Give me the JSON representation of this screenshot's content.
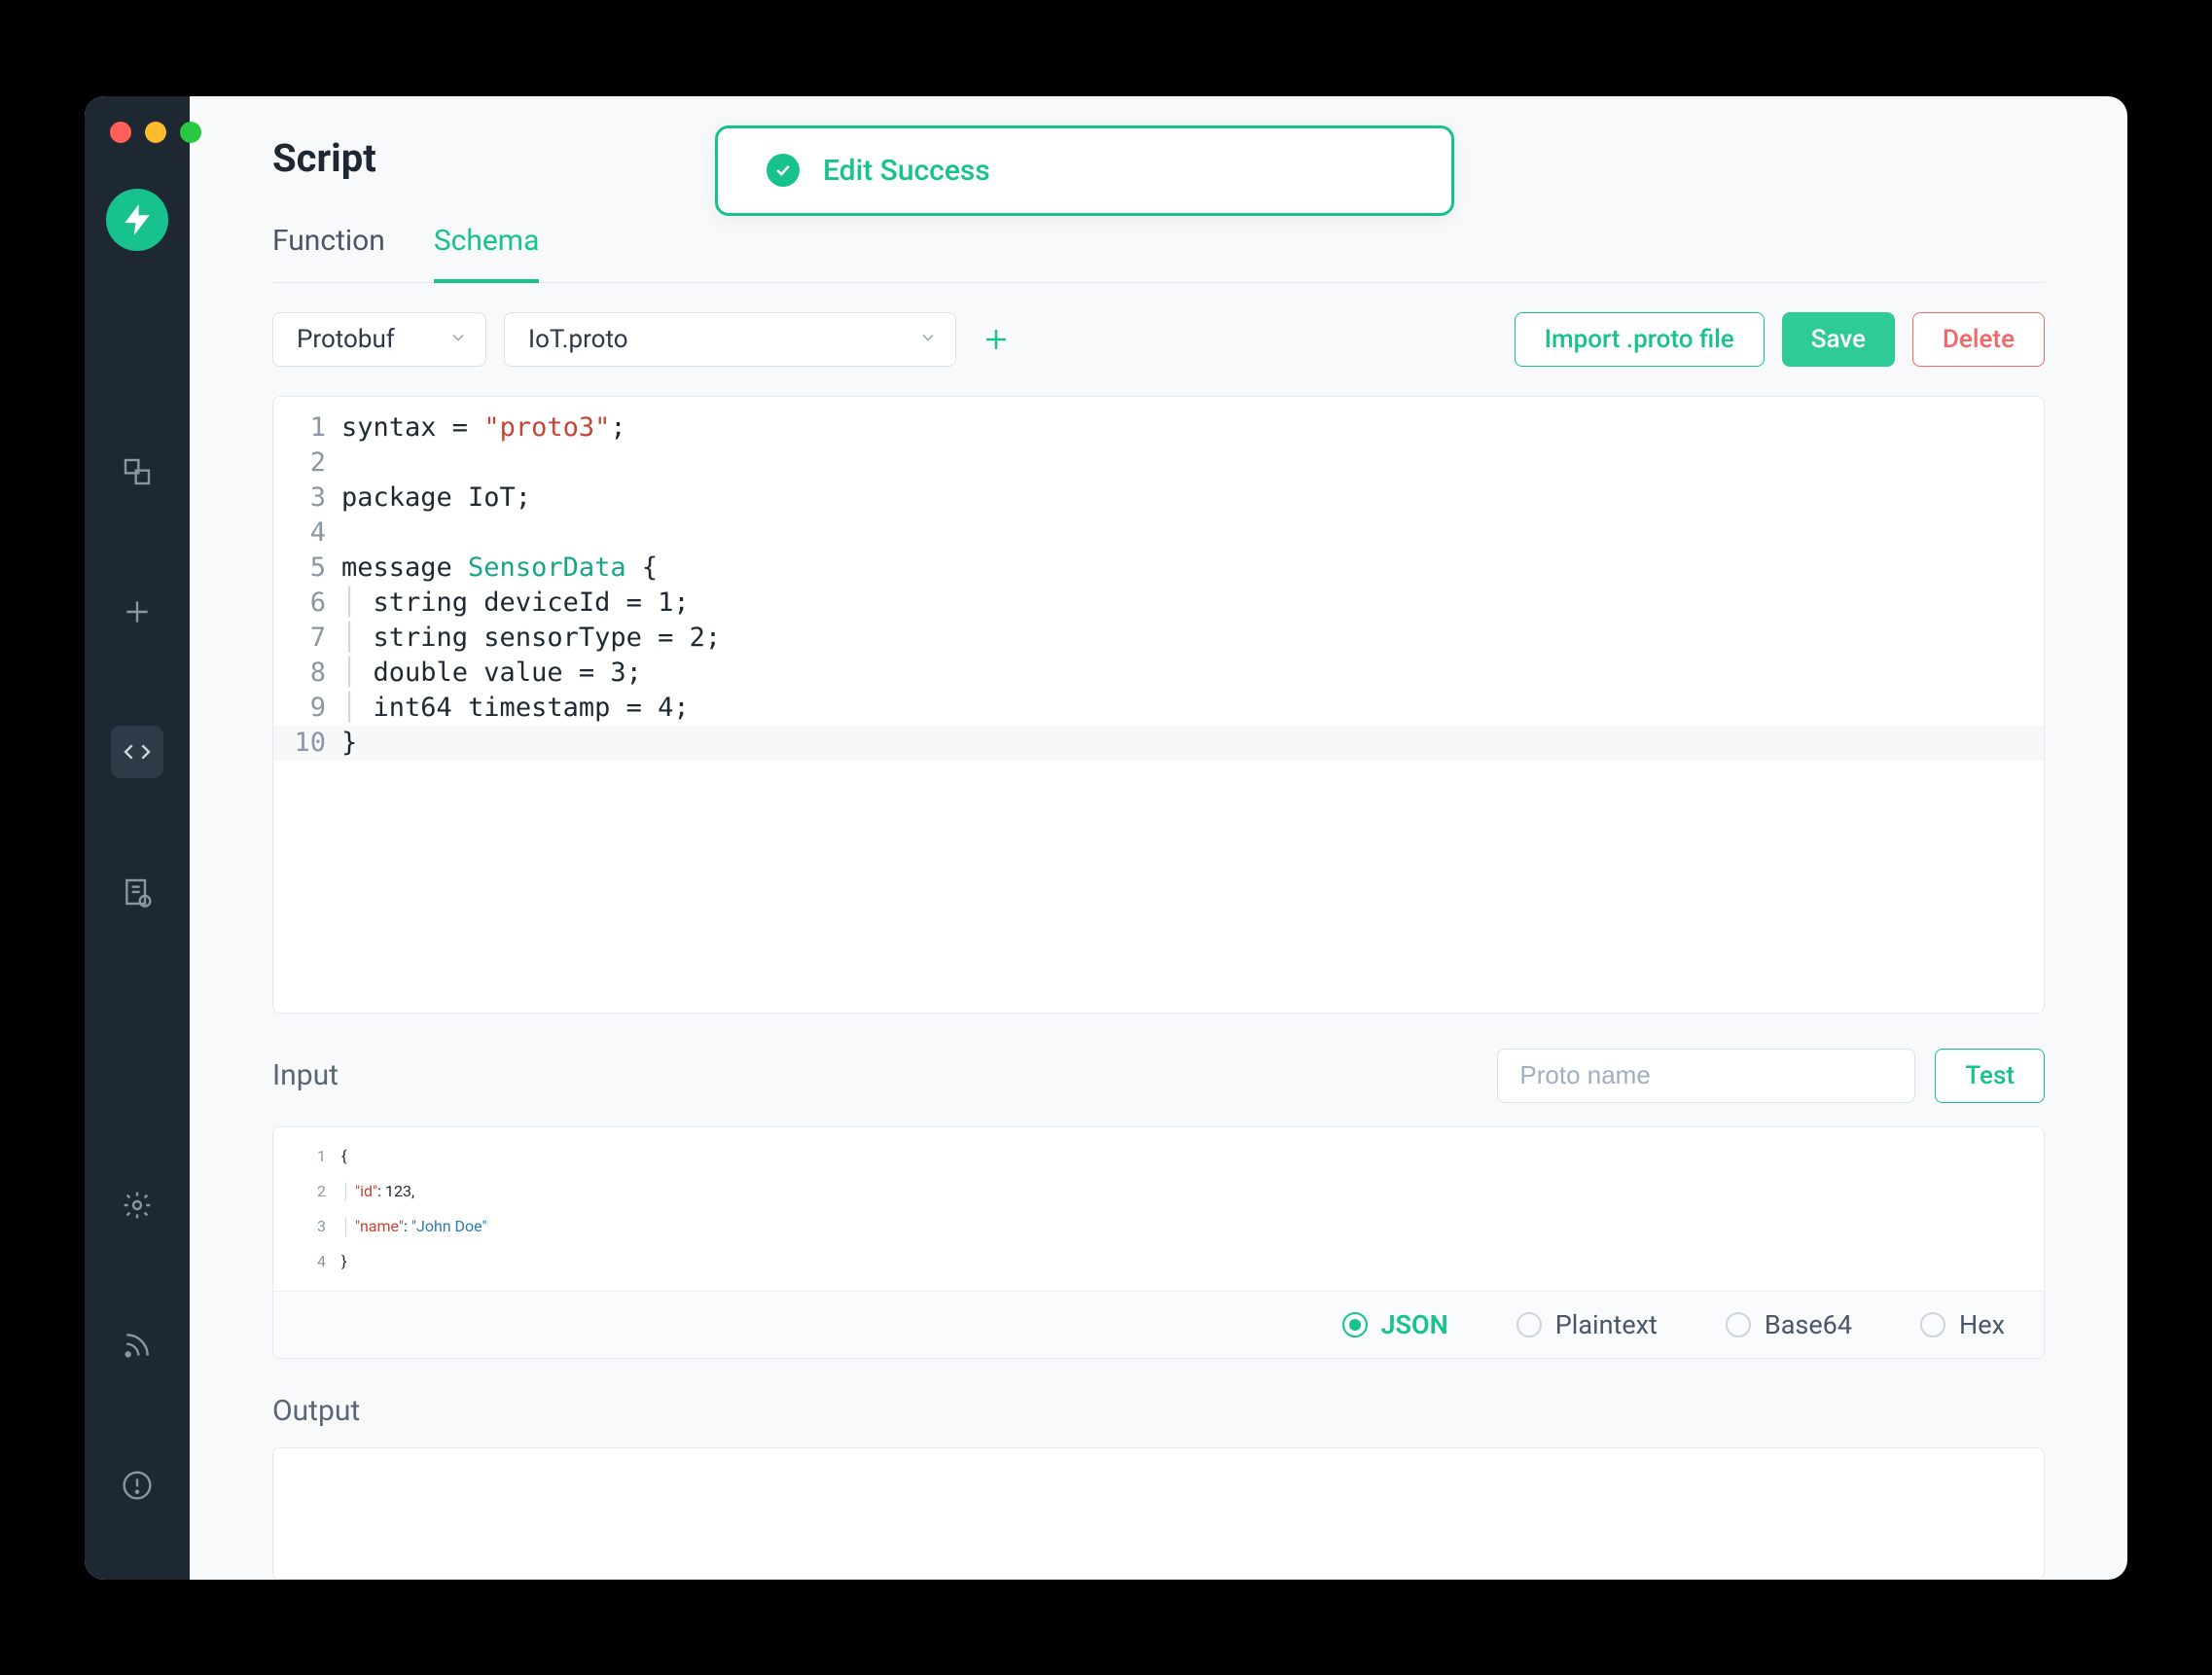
{
  "page": {
    "title": "Script"
  },
  "toast": {
    "message": "Edit Success"
  },
  "tabs": [
    {
      "label": "Function",
      "active": false
    },
    {
      "label": "Schema",
      "active": true
    }
  ],
  "toolbar": {
    "schema_type": "Protobuf",
    "file_name": "IoT.proto",
    "import_label": "Import .proto file",
    "save_label": "Save",
    "delete_label": "Delete"
  },
  "editor": {
    "lines": [
      {
        "n": 1,
        "segs": [
          [
            "",
            "syntax = "
          ],
          [
            "str",
            "\"proto3\""
          ],
          [
            "",
            ";"
          ]
        ]
      },
      {
        "n": 2,
        "segs": [
          [
            "",
            ""
          ]
        ]
      },
      {
        "n": 3,
        "segs": [
          [
            "",
            "package IoT;"
          ]
        ]
      },
      {
        "n": 4,
        "segs": [
          [
            "",
            ""
          ]
        ]
      },
      {
        "n": 5,
        "segs": [
          [
            "",
            "message "
          ],
          [
            "type",
            "SensorData"
          ],
          [
            "",
            " {"
          ]
        ]
      },
      {
        "n": 6,
        "segs": [
          [
            "guide",
            "│ "
          ],
          [
            "",
            "string deviceId = 1;"
          ]
        ]
      },
      {
        "n": 7,
        "segs": [
          [
            "guide",
            "│ "
          ],
          [
            "",
            "string sensorType = 2;"
          ]
        ]
      },
      {
        "n": 8,
        "segs": [
          [
            "guide",
            "│ "
          ],
          [
            "",
            "double value = 3;"
          ]
        ]
      },
      {
        "n": 9,
        "segs": [
          [
            "guide",
            "│ "
          ],
          [
            "",
            "int64 timestamp = 4;"
          ]
        ]
      },
      {
        "n": 10,
        "segs": [
          [
            "",
            "}"
          ]
        ],
        "hl": true
      }
    ]
  },
  "input": {
    "label": "Input",
    "proto_name_placeholder": "Proto name",
    "test_label": "Test",
    "lines": [
      {
        "n": 1,
        "segs": [
          [
            "",
            "{"
          ]
        ]
      },
      {
        "n": 2,
        "segs": [
          [
            "guide",
            "│ "
          ],
          [
            "key",
            "\"id\""
          ],
          [
            "",
            ": "
          ],
          [
            "vnum",
            "123"
          ],
          [
            "",
            ","
          ]
        ]
      },
      {
        "n": 3,
        "segs": [
          [
            "guide",
            "│ "
          ],
          [
            "key",
            "\"name\""
          ],
          [
            "",
            ": "
          ],
          [
            "vstr",
            "\"John Doe\""
          ]
        ]
      },
      {
        "n": 4,
        "segs": [
          [
            "",
            "}"
          ]
        ]
      }
    ],
    "format_options": [
      {
        "label": "JSON",
        "selected": true
      },
      {
        "label": "Plaintext",
        "selected": false
      },
      {
        "label": "Base64",
        "selected": false
      },
      {
        "label": "Hex",
        "selected": false
      }
    ]
  },
  "output": {
    "label": "Output"
  }
}
